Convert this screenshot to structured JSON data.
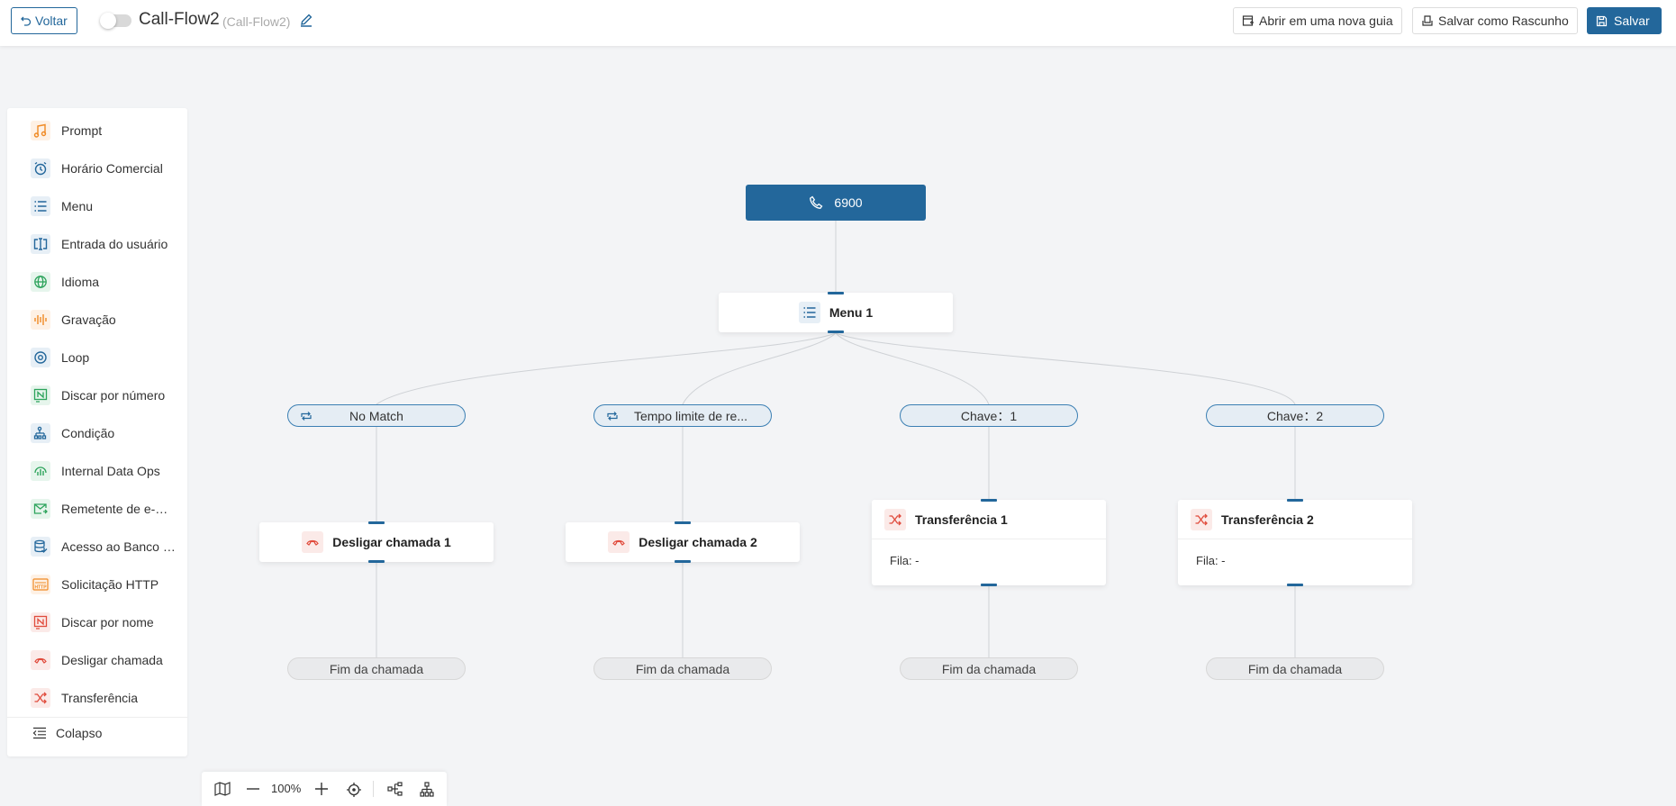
{
  "header": {
    "back_label": "Voltar",
    "title": "Call-Flow2",
    "subtitle": "(Call-Flow2)",
    "open_new_tab_label": "Abrir em uma nova guia",
    "save_draft_label": "Salvar como Rascunho",
    "save_label": "Salvar"
  },
  "sidebar": {
    "items": [
      {
        "label": "Prompt",
        "icon": "music-note-icon",
        "color": "#f08a24"
      },
      {
        "label": "Horário Comercial",
        "icon": "alarm-clock-icon",
        "color": "#23679b"
      },
      {
        "label": "Menu",
        "icon": "list-icon",
        "color": "#23679b"
      },
      {
        "label": "Entrada do usuário",
        "icon": "text-input-icon",
        "color": "#23679b"
      },
      {
        "label": "Idioma",
        "icon": "globe-icon",
        "color": "#2ca35b"
      },
      {
        "label": "Gravação",
        "icon": "audio-wave-icon",
        "color": "#f08a24"
      },
      {
        "label": "Loop",
        "icon": "loop-icon",
        "color": "#23679b"
      },
      {
        "label": "Discar por número",
        "icon": "dial-number-icon",
        "color": "#2ca35b"
      },
      {
        "label": "Condição",
        "icon": "condition-icon",
        "color": "#23679b"
      },
      {
        "label": "Internal Data Ops",
        "icon": "data-ops-icon",
        "color": "#2ca35b"
      },
      {
        "label": "Remetente de e-mail",
        "icon": "email-icon",
        "color": "#2ca35b"
      },
      {
        "label": "Acesso ao Banco de Dados",
        "icon": "database-icon",
        "color": "#23679b"
      },
      {
        "label": "Solicitação HTTP",
        "icon": "http-icon",
        "color": "#f08a24"
      },
      {
        "label": "Discar por nome",
        "icon": "dial-name-icon",
        "color": "#e04b3c"
      },
      {
        "label": "Desligar chamada",
        "icon": "hang-up-icon",
        "color": "#e04b3c"
      },
      {
        "label": "Transferência",
        "icon": "shuffle-icon",
        "color": "#e04b3c"
      }
    ],
    "collapse_label": "Colapso"
  },
  "flow": {
    "start_label": "6900",
    "menu_node": "Menu 1",
    "branches": [
      {
        "pill": "No Match",
        "node": "Desligar chamada 1",
        "type": "hangup",
        "end": "Fim da chamada"
      },
      {
        "pill": "Tempo limite de re...",
        "node": "Desligar chamada 2",
        "type": "hangup",
        "end": "Fim da chamada"
      },
      {
        "pill": "Chave：1",
        "node": "Transferência 1",
        "type": "transfer",
        "queue": "Fila: -",
        "end": "Fim da chamada"
      },
      {
        "pill": "Chave：2",
        "node": "Transferência 2",
        "type": "transfer",
        "queue": "Fila: -",
        "end": "Fim da chamada"
      }
    ]
  },
  "zoom": {
    "level": "100%"
  },
  "colors": {
    "primary": "#23679b",
    "danger": "#e04b3c",
    "warning": "#f08a24",
    "success": "#2ca35b"
  }
}
